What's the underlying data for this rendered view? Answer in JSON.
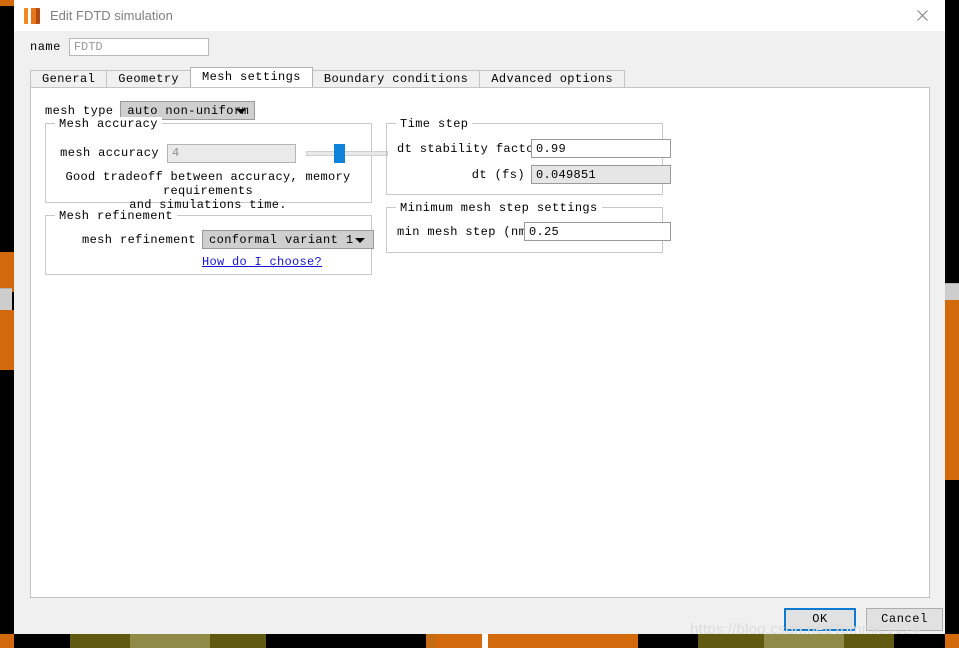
{
  "window": {
    "title": "Edit FDTD simulation",
    "icon": "lumerical-app-icon",
    "close_label": "✕"
  },
  "name_field": {
    "label": "name",
    "value": "FDTD"
  },
  "tabs": [
    {
      "label": "General",
      "active": false
    },
    {
      "label": "Geometry",
      "active": false
    },
    {
      "label": "Mesh settings",
      "active": true
    },
    {
      "label": "Boundary conditions",
      "active": false
    },
    {
      "label": "Advanced options",
      "active": false
    }
  ],
  "mesh_type": {
    "label": "mesh type",
    "value": "auto non-uniform"
  },
  "mesh_accuracy": {
    "group_title": "Mesh accuracy",
    "label": "mesh accuracy",
    "value": "4",
    "slider_percent": 40,
    "helper_line1": "Good tradeoff between accuracy, memory requirements",
    "helper_line2": "and simulations time."
  },
  "mesh_refinement": {
    "group_title": "Mesh refinement",
    "label": "mesh refinement",
    "value": "conformal variant 1",
    "link_label": "How do I choose?"
  },
  "time_step": {
    "group_title": "Time step",
    "stability_label": "dt stability factor",
    "stability_value": "0.99",
    "dt_label": "dt (fs)",
    "dt_value": "0.049851"
  },
  "min_mesh_step": {
    "group_title": "Minimum mesh step settings",
    "label": "min mesh step (nm)",
    "value": "0.25"
  },
  "footer": {
    "ok_label": "OK",
    "cancel_label": "Cancel"
  },
  "watermark": {
    "text": "https://blog.csdn.net/Tommic1024"
  },
  "colors": {
    "accent_blue": "#0d82d8",
    "focus_blue": "#0d7ad0",
    "link_blue": "#1414d2",
    "orange_edge": "#d2690a",
    "dialog_bg": "#f0f0f0"
  }
}
